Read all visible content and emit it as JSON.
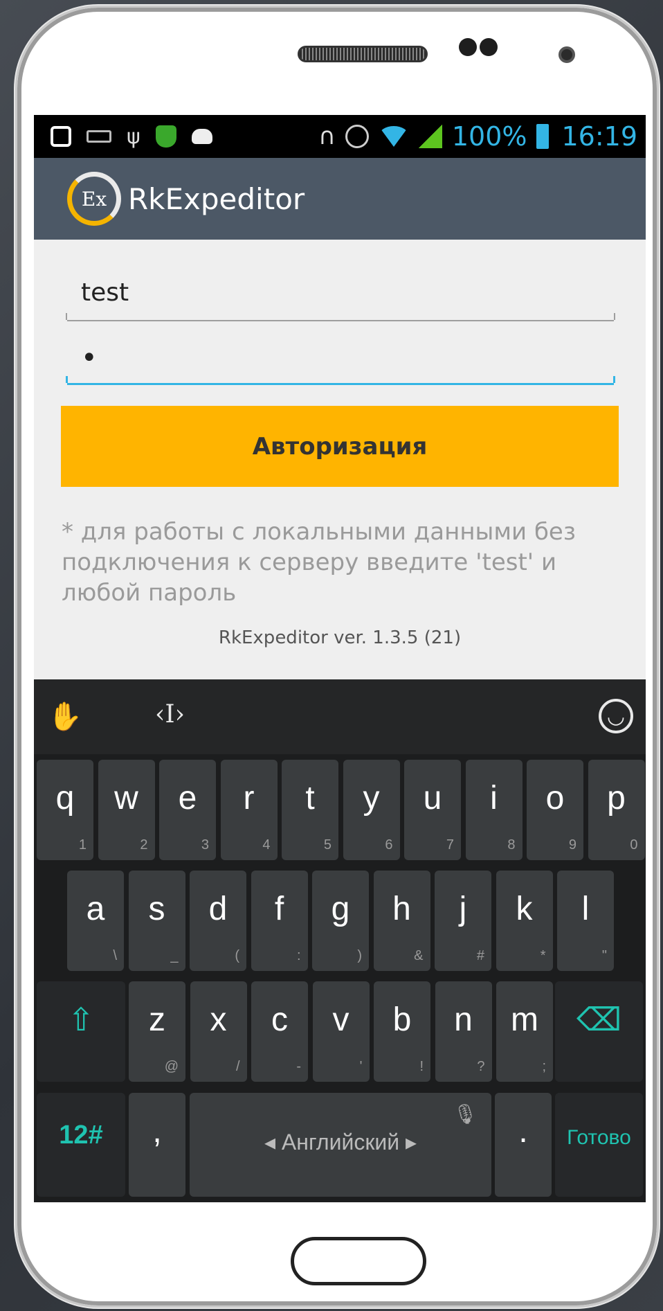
{
  "status_bar": {
    "battery_percent": "100%",
    "time": "16:19",
    "icons": [
      "home-icon",
      "keyboard-icon",
      "usb-icon",
      "shield-icon",
      "android-icon",
      "headphones-icon",
      "alarm-icon",
      "wifi-icon",
      "signal-icon",
      "battery-icon"
    ]
  },
  "app_bar": {
    "logo_text": "Ex",
    "title": "RkExpeditor"
  },
  "form": {
    "username_value": "test",
    "password_mask": "•",
    "auth_button": "Авторизация",
    "hint": "* для работы с локальными данными без подключения к серверу введите 'test' и любой пароль",
    "version": "RkExpeditor ver. 1.3.5 (21)"
  },
  "keyboard": {
    "row1": [
      {
        "k": "q",
        "s": "1"
      },
      {
        "k": "w",
        "s": "2"
      },
      {
        "k": "e",
        "s": "3"
      },
      {
        "k": "r",
        "s": "4"
      },
      {
        "k": "t",
        "s": "5"
      },
      {
        "k": "y",
        "s": "6"
      },
      {
        "k": "u",
        "s": "7"
      },
      {
        "k": "i",
        "s": "8"
      },
      {
        "k": "o",
        "s": "9"
      },
      {
        "k": "p",
        "s": "0"
      }
    ],
    "row2": [
      {
        "k": "a",
        "s": "\\"
      },
      {
        "k": "s",
        "s": "_"
      },
      {
        "k": "d",
        "s": "("
      },
      {
        "k": "f",
        "s": ":"
      },
      {
        "k": "g",
        "s": ")"
      },
      {
        "k": "h",
        "s": "&"
      },
      {
        "k": "j",
        "s": "#"
      },
      {
        "k": "k",
        "s": "*"
      },
      {
        "k": "l",
        "s": "\""
      }
    ],
    "row3": [
      {
        "k": "z",
        "s": "@"
      },
      {
        "k": "x",
        "s": "/"
      },
      {
        "k": "c",
        "s": "-"
      },
      {
        "k": "v",
        "s": "'"
      },
      {
        "k": "b",
        "s": "!"
      },
      {
        "k": "n",
        "s": "?"
      },
      {
        "k": "m",
        "s": ";"
      }
    ],
    "shift": "⇧",
    "backspace": "⌫",
    "numbers": "12#",
    "comma": ",",
    "space": "◂ Английский ▸",
    "period": ".",
    "done": "Готово"
  }
}
